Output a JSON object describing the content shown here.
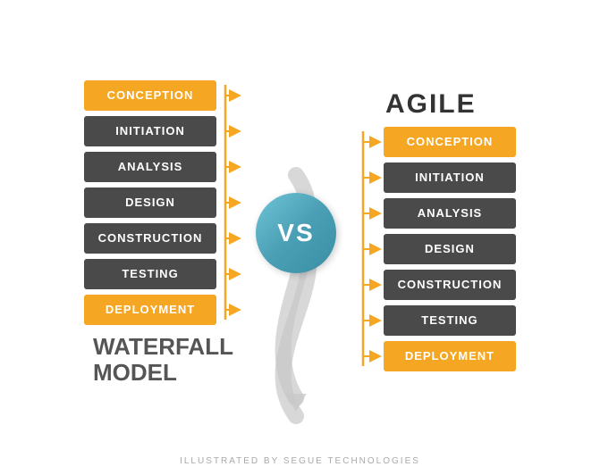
{
  "waterfall": {
    "title": "WATERFALL\nMODEL",
    "steps": [
      {
        "label": "CONCEPTION",
        "type": "orange"
      },
      {
        "label": "INITIATION",
        "type": "dark"
      },
      {
        "label": "ANALYSIS",
        "type": "dark"
      },
      {
        "label": "DESIGN",
        "type": "dark"
      },
      {
        "label": "CONSTRUCTION",
        "type": "dark"
      },
      {
        "label": "TESTING",
        "type": "dark"
      },
      {
        "label": "DEPLOYMENT",
        "type": "orange"
      }
    ]
  },
  "vs": {
    "label": "VS"
  },
  "agile": {
    "title": "AGILE",
    "steps": [
      {
        "label": "CONCEPTION",
        "type": "orange"
      },
      {
        "label": "INITIATION",
        "type": "dark"
      },
      {
        "label": "ANALYSIS",
        "type": "dark"
      },
      {
        "label": "DESIGN",
        "type": "dark"
      },
      {
        "label": "CONSTRUCTION",
        "type": "dark"
      },
      {
        "label": "TESTING",
        "type": "dark"
      },
      {
        "label": "DEPLOYMENT",
        "type": "orange"
      }
    ]
  },
  "footer": {
    "text": "ILLUSTRATED BY SEGUE TECHNOLOGIES"
  }
}
